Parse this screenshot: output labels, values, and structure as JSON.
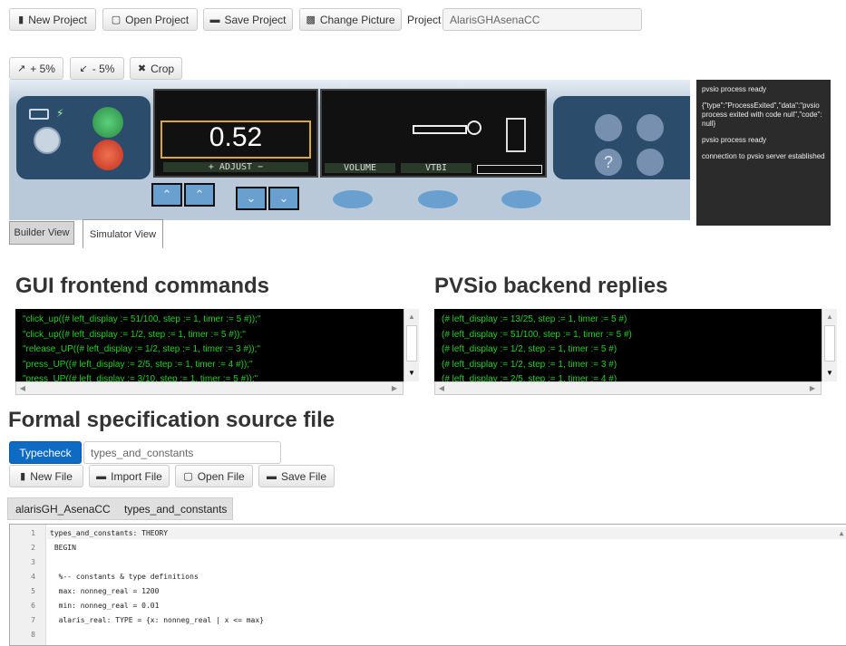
{
  "toolbar": {
    "new_project": "New Project",
    "open_project": "Open Project",
    "save_project": "Save Project",
    "change_picture": "Change Picture",
    "project_label": "Project",
    "project_name": "AlarisGHAsenaCC"
  },
  "zoom": {
    "zoom_in": "+ 5%",
    "zoom_out": "- 5%",
    "crop": "Crop"
  },
  "device": {
    "display_value": "0.52",
    "adjust_label": "+  ADJUST  −",
    "volume_label": "VOLUME",
    "vtbi_label": "VTBI"
  },
  "status_console": [
    "pvsio process ready",
    "{\"type\":\"ProcessExited\",\"data\":\"pvsio process exited with code null\",\"code\":null}",
    "pvsio process ready",
    "connection to pvsio server established"
  ],
  "view_tabs": {
    "builder": "Builder View",
    "simulator": "Simulator View"
  },
  "gui_commands": {
    "title": "GUI frontend commands",
    "lines": [
      "\"click_up((# left_display := 51/100, step := 1, timer := 5 #));\"",
      "\"click_up((# left_display := 1/2, step := 1, timer := 5 #));\"",
      "\"release_UP((# left_display := 1/2, step := 1, timer := 3 #));\"",
      "\"press_UP((# left_display := 2/5, step := 1, timer := 4 #));\"",
      "\"press_UP((# left_display := 3/10, step := 1, timer := 5 #));\""
    ]
  },
  "backend_replies": {
    "title": "PVSio backend replies",
    "lines": [
      "(# left_display := 13/25, step := 1, timer := 5 #)",
      "(# left_display := 51/100, step := 1, timer := 5 #)",
      "(# left_display := 1/2, step := 1, timer := 5 #)",
      "(# left_display := 1/2, step := 1, timer := 3 #)",
      "(# left_display := 2/5, step := 1, timer := 4 #)"
    ]
  },
  "spec": {
    "title": "Formal specification source file",
    "typecheck": "Typecheck",
    "filename": "types_and_constants",
    "new_file": "New File",
    "import_file": "Import File",
    "open_file": "Open File",
    "save_file": "Save File",
    "tabs": [
      "alarisGH_AsenaCC",
      "types_and_constants"
    ]
  },
  "editor": {
    "lines": [
      {
        "n": "1",
        "text": "types_and_constants: THEORY"
      },
      {
        "n": "2",
        "text": " BEGIN"
      },
      {
        "n": "3",
        "text": ""
      },
      {
        "n": "4",
        "text": "  %-- constants & type definitions"
      },
      {
        "n": "5",
        "text": "  max: nonneg_real = 1200"
      },
      {
        "n": "6",
        "text": "  min: nonneg_real = 0.01"
      },
      {
        "n": "7",
        "text": "  alaris_real: TYPE = {x: nonneg_real | x <= max}"
      },
      {
        "n": "8",
        "text": ""
      }
    ]
  },
  "colors": {
    "typecheck_bg": "#0d6bc4",
    "console_green": "#1fd31f",
    "device_body": "#b9c9d9",
    "status_console_bg": "#2b2b2b"
  }
}
